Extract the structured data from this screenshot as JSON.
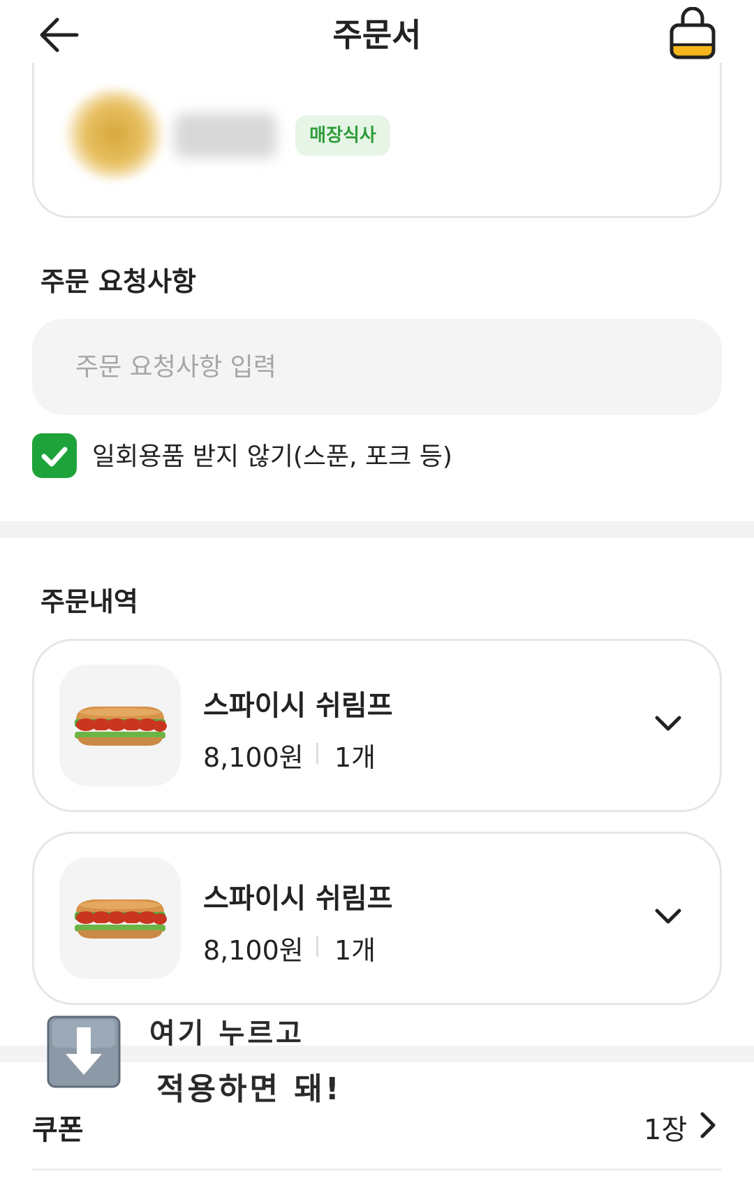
{
  "header": {
    "title": "주문서",
    "back_icon": "arrow-left-icon",
    "cart_icon": "shopping-bag-icon"
  },
  "store": {
    "badge": "매장식사"
  },
  "request": {
    "section_title": "주문 요청사항",
    "placeholder": "주문 요청사항 입력",
    "value": "",
    "no_utensils_label": "일회용품 받지 않기(스푼, 포크 등)",
    "no_utensils_checked": true
  },
  "order": {
    "section_title": "주문내역",
    "items": [
      {
        "name": "스파이시 쉬림프",
        "price": "8,100원",
        "quantity": "1개"
      },
      {
        "name": "스파이시 쉬림프",
        "price": "8,100원",
        "quantity": "1개"
      }
    ]
  },
  "annotation": {
    "line1": "여기 누르고",
    "line2": "적용하면 돼!"
  },
  "coupon": {
    "label": "쿠폰",
    "count": "1장"
  },
  "colors": {
    "accent_green": "#1ea33a",
    "badge_bg": "#e6f5e6",
    "cart_fill": "#f5b51b"
  }
}
